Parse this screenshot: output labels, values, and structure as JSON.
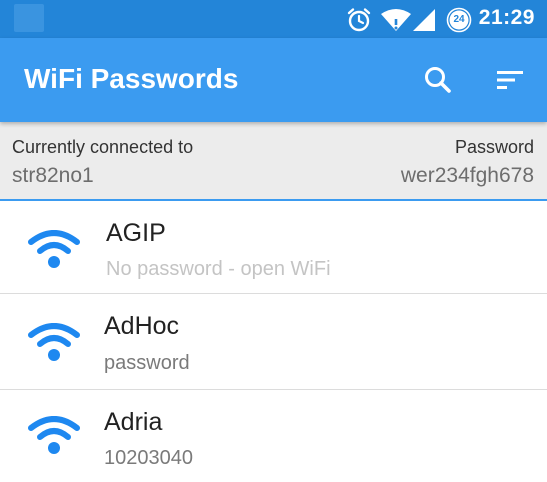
{
  "status_bar": {
    "time": "21:29",
    "badge": "24",
    "icons": [
      "notification-square",
      "alarm-icon",
      "wifi-signal-icon",
      "cell-signal-icon",
      "battery-saver-icon"
    ]
  },
  "app_bar": {
    "title": "WiFi Passwords",
    "actions": [
      "search-icon",
      "sort-icon"
    ]
  },
  "connected": {
    "label": "Currently connected to",
    "ssid": "str82no1",
    "password_label": "Password",
    "password": "wer234fgh678"
  },
  "networks": [
    {
      "ssid": "AGIP",
      "password": "No password - open WiFi",
      "open": true
    },
    {
      "ssid": "AdHoc",
      "password": "password",
      "open": false
    },
    {
      "ssid": "Adria",
      "password": "10203040",
      "open": false
    }
  ],
  "colors": {
    "status_bar": "#2385d8",
    "app_bar": "#3b9bf0",
    "wifi_icon": "#1e88f0",
    "connected_bg": "#ececec"
  }
}
